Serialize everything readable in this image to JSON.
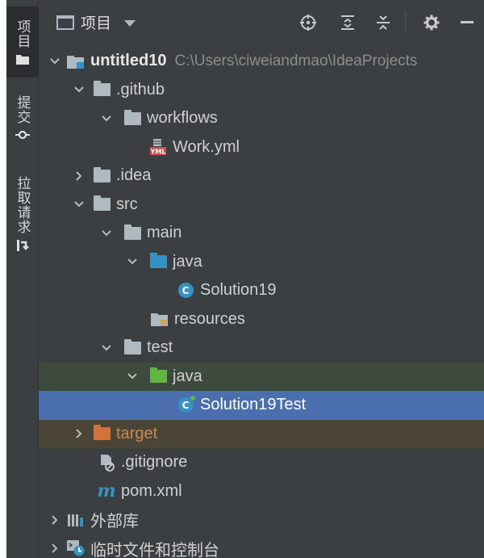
{
  "sidebar": {
    "tabs": [
      {
        "label": "项目",
        "icon": "folder-icon",
        "active": true
      },
      {
        "label": "提交",
        "icon": "commit-icon",
        "active": false
      },
      {
        "label": "拉取请求",
        "icon": "pull-request-icon",
        "active": false
      }
    ]
  },
  "toolbar": {
    "title": "项目",
    "buttons": [
      "locate-icon",
      "expand-all-icon",
      "collapse-all-icon",
      "gear-icon",
      "minimize-icon"
    ]
  },
  "tree": {
    "project_name": "untitled10",
    "project_path": "C:\\Users\\ciweiandmao\\IdeaProjects",
    "items": [
      {
        "label": ".github",
        "icon": "folder-icon"
      },
      {
        "label": "workflows",
        "icon": "folder-icon"
      },
      {
        "label": "Work.yml",
        "icon": "yml-file-icon"
      },
      {
        "label": ".idea",
        "icon": "folder-icon"
      },
      {
        "label": "src",
        "icon": "folder-icon"
      },
      {
        "label": "main",
        "icon": "folder-icon"
      },
      {
        "label": "java",
        "icon": "source-folder-icon"
      },
      {
        "label": "Solution19",
        "icon": "java-class-icon"
      },
      {
        "label": "resources",
        "icon": "resources-folder-icon"
      },
      {
        "label": "test",
        "icon": "folder-icon"
      },
      {
        "label": "java",
        "icon": "test-source-folder-icon"
      },
      {
        "label": "Solution19Test",
        "icon": "java-test-class-icon"
      },
      {
        "label": "target",
        "icon": "excluded-folder-icon"
      },
      {
        "label": ".gitignore",
        "icon": "ignored-file-icon"
      },
      {
        "label": "pom.xml",
        "icon": "maven-icon"
      },
      {
        "label": "外部库",
        "icon": "libraries-icon"
      },
      {
        "label": "临时文件和控制台",
        "icon": "scratches-icon"
      }
    ]
  },
  "colors": {
    "selected_row": "#4b6eaf",
    "test_row": "#3f4a3f",
    "excluded_row": "#4a4536",
    "panel_bg": "#3c3f41"
  }
}
